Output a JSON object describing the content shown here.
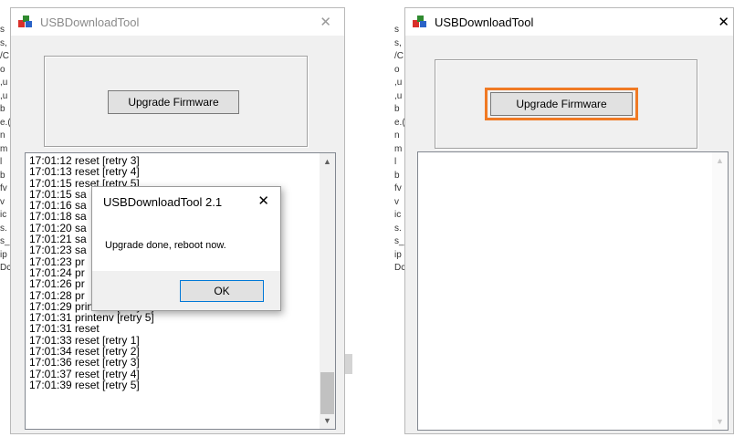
{
  "background_strip_left": [
    "s",
    "s,",
    "/C",
    "o",
    ",u",
    ",u",
    "b",
    "e.(",
    "n",
    "m",
    "l",
    "b",
    "fv",
    "v",
    "ic",
    "s.",
    "s_",
    "ip",
    "Dc"
  ],
  "background_strip_right": [
    "s",
    "s,",
    "/C",
    "o",
    ",u",
    ",u",
    "b",
    "e.(",
    "n",
    "m",
    "l",
    "b",
    "fv",
    "v",
    "ic",
    "s.",
    "s_",
    "ip",
    "Dc"
  ],
  "left_window": {
    "title": "USBDownloadTool",
    "close_glyph": "✕",
    "upgrade_button": "Upgrade Firmware",
    "log_lines": [
      "17:01:12 reset [retry 3]",
      "17:01:13 reset [retry 4]",
      "17:01:15 reset [retry 5]",
      "17:01:15 sa",
      "17:01:16 sa",
      "17:01:18 sa",
      "17:01:20 sa",
      "17:01:21 sa",
      "17:01:23 sa",
      "17:01:23 pr",
      "17:01:24 pr",
      "17:01:26 pr",
      "17:01:28 pr",
      "17:01:29 printenv [retry 4]",
      "17:01:31 printenv [retry 5]",
      "17:01:31 reset",
      "17:01:33 reset [retry 1]",
      "17:01:34 reset [retry 2]",
      "17:01:36 reset [retry 3]",
      "17:01:37 reset [retry 4]",
      "17:01:39 reset [retry 5]"
    ]
  },
  "dialog": {
    "title": "USBDownloadTool 2.1",
    "close_glyph": "✕",
    "message": "Upgrade done, reboot now.",
    "ok_button": "OK"
  },
  "right_window": {
    "title": "USBDownloadTool",
    "close_glyph": "✕",
    "upgrade_button": "Upgrade Firmware",
    "highlight_color": "#f07a24"
  },
  "scroll_glyphs": {
    "up": "▲",
    "down": "▼"
  }
}
